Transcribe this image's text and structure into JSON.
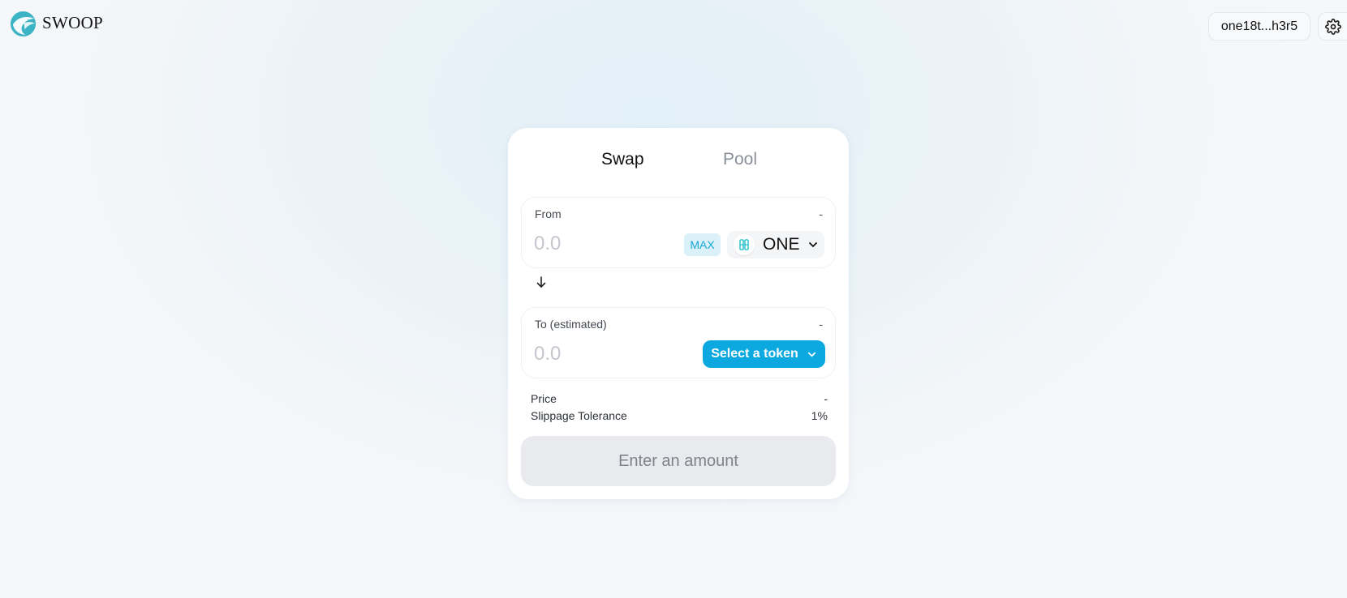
{
  "header": {
    "brand": "SWOOP",
    "logo_icon": "swoop-bird-icon",
    "wallet_address": "one18t...h3r5",
    "settings_icon": "gear-icon"
  },
  "tabs": [
    {
      "label": "Swap",
      "active": true
    },
    {
      "label": "Pool",
      "active": false
    }
  ],
  "from": {
    "label": "From",
    "balance": "-",
    "amount_placeholder": "0.0",
    "amount_value": "",
    "max_label": "MAX",
    "token_symbol": "ONE",
    "token_icon": "harmony-one-icon"
  },
  "direction_icon": "arrow-down-icon",
  "to": {
    "label": "To (estimated)",
    "balance": "-",
    "amount_placeholder": "0.0",
    "amount_value": "",
    "select_token_label": "Select a token"
  },
  "info": {
    "price_label": "Price",
    "price_value": "-",
    "slippage_label": "Slippage Tolerance",
    "slippage_value": "1%"
  },
  "submit_label": "Enter an amount",
  "colors": {
    "accent": "#0ca8e0",
    "max_bg": "#dbf1f9",
    "max_text": "#19a8d6",
    "disabled_bg": "#e8eaed",
    "disabled_text": "#7e838b",
    "token_icon": "#3cc7cf"
  }
}
